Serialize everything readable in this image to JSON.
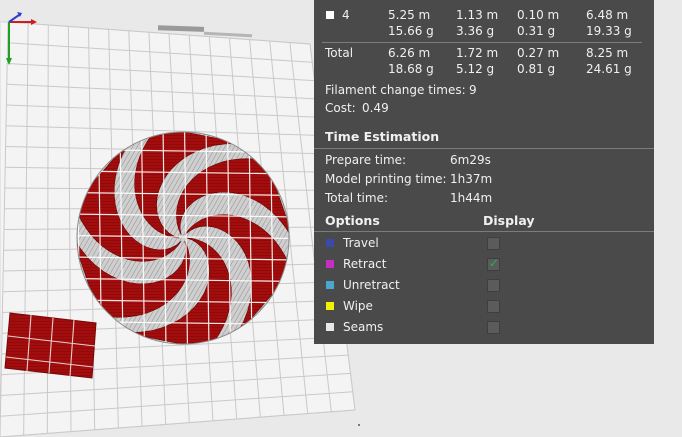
{
  "filament_table": {
    "rows": [
      {
        "label": "4",
        "has_swatch": true,
        "swatch_color": "#ffffff",
        "cols": [
          [
            "5.25 m",
            "15.66 g"
          ],
          [
            "1.13 m",
            "3.36 g"
          ],
          [
            "0.10 m",
            "0.31 g"
          ],
          [
            "6.48 m",
            "19.33 g"
          ]
        ]
      }
    ],
    "total": {
      "label": "Total",
      "cols": [
        [
          "6.26 m",
          "18.68 g"
        ],
        [
          "1.72 m",
          "5.12 g"
        ],
        [
          "0.27 m",
          "0.81 g"
        ],
        [
          "8.25 m",
          "24.61 g"
        ]
      ]
    }
  },
  "filament_change": {
    "label": "Filament change times:",
    "value": "9"
  },
  "cost": {
    "label": "Cost:",
    "value": "0.49"
  },
  "time_estimation": {
    "title": "Time Estimation",
    "rows": [
      {
        "label": "Prepare time:",
        "value": "6m29s"
      },
      {
        "label": "Model printing time:",
        "value": "1h37m"
      },
      {
        "label": "Total time:",
        "value": "1h44m"
      }
    ]
  },
  "options": {
    "header_options": "Options",
    "header_display": "Display",
    "items": [
      {
        "label": "Travel",
        "color": "#3b4aa8",
        "checked": false
      },
      {
        "label": "Retract",
        "color": "#c62ec2",
        "checked": true
      },
      {
        "label": "Unretract",
        "color": "#4aa8cf",
        "checked": false
      },
      {
        "label": "Wipe",
        "color": "#f2f200",
        "checked": false
      },
      {
        "label": "Seams",
        "color": "#e8e8e8",
        "checked": false
      }
    ]
  },
  "check_glyph": "✓",
  "colors": {
    "panel_bg": "#4a4a4a",
    "model_red": "#a30d0d",
    "model_grey": "#c6c6c6",
    "bed": "#f3f3f3"
  }
}
